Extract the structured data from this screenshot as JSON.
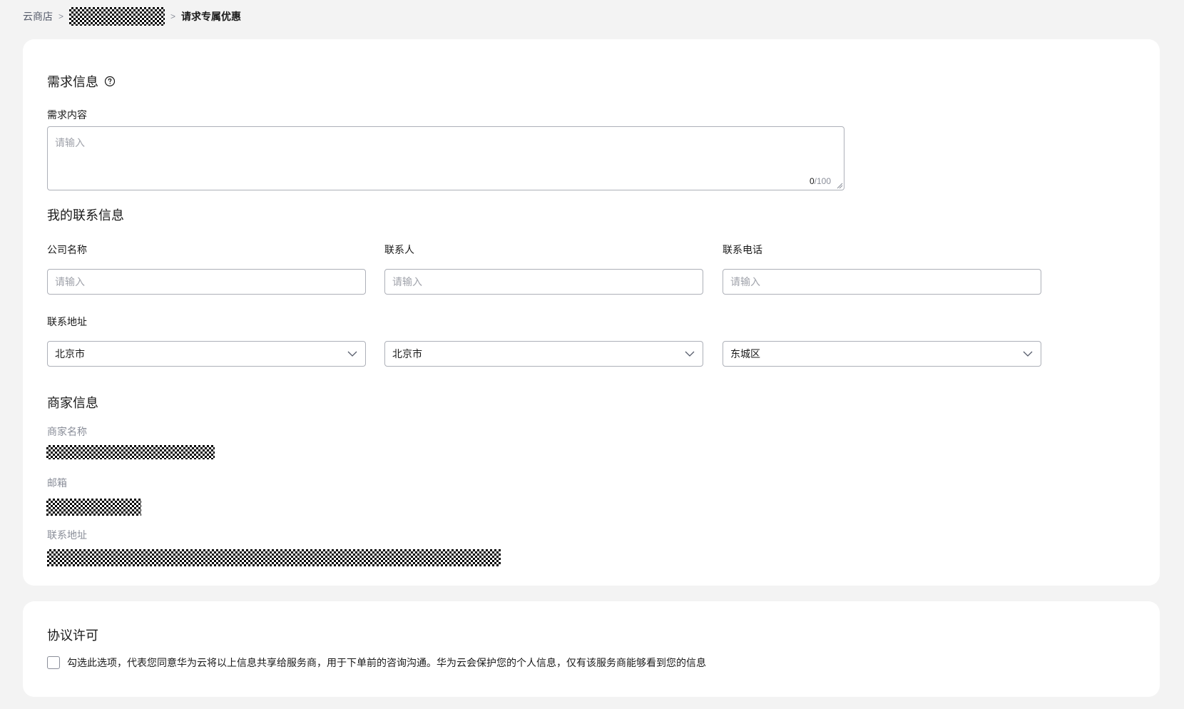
{
  "breadcrumb": {
    "home": "云商店",
    "separator": ">",
    "current": "请求专属优惠"
  },
  "requirement": {
    "section_title": "需求信息",
    "content_label": "需求内容",
    "content_placeholder": "请输入",
    "counter_current": "0",
    "counter_max": "/100"
  },
  "contact": {
    "section_title": "我的联系信息",
    "company_label": "公司名称",
    "company_placeholder": "请输入",
    "person_label": "联系人",
    "person_placeholder": "请输入",
    "phone_label": "联系电话",
    "phone_placeholder": "请输入",
    "address_label": "联系地址",
    "province": "北京市",
    "city": "北京市",
    "district": "东城区"
  },
  "merchant": {
    "section_title": "商家信息",
    "name_label": "商家名称",
    "email_label": "邮箱",
    "address_label": "联系地址"
  },
  "agreement": {
    "section_title": "协议许可",
    "checkbox_checked": false,
    "checkbox_text": "勾选此选项，代表您同意华为云将以上信息共享给服务商，用于下单前的咨询沟通。华为云会保护您的个人信息，仅有该服务商能够看到您的信息"
  },
  "icons": {
    "help": "question-circle-icon",
    "dropdown": "chevron-down-icon"
  }
}
